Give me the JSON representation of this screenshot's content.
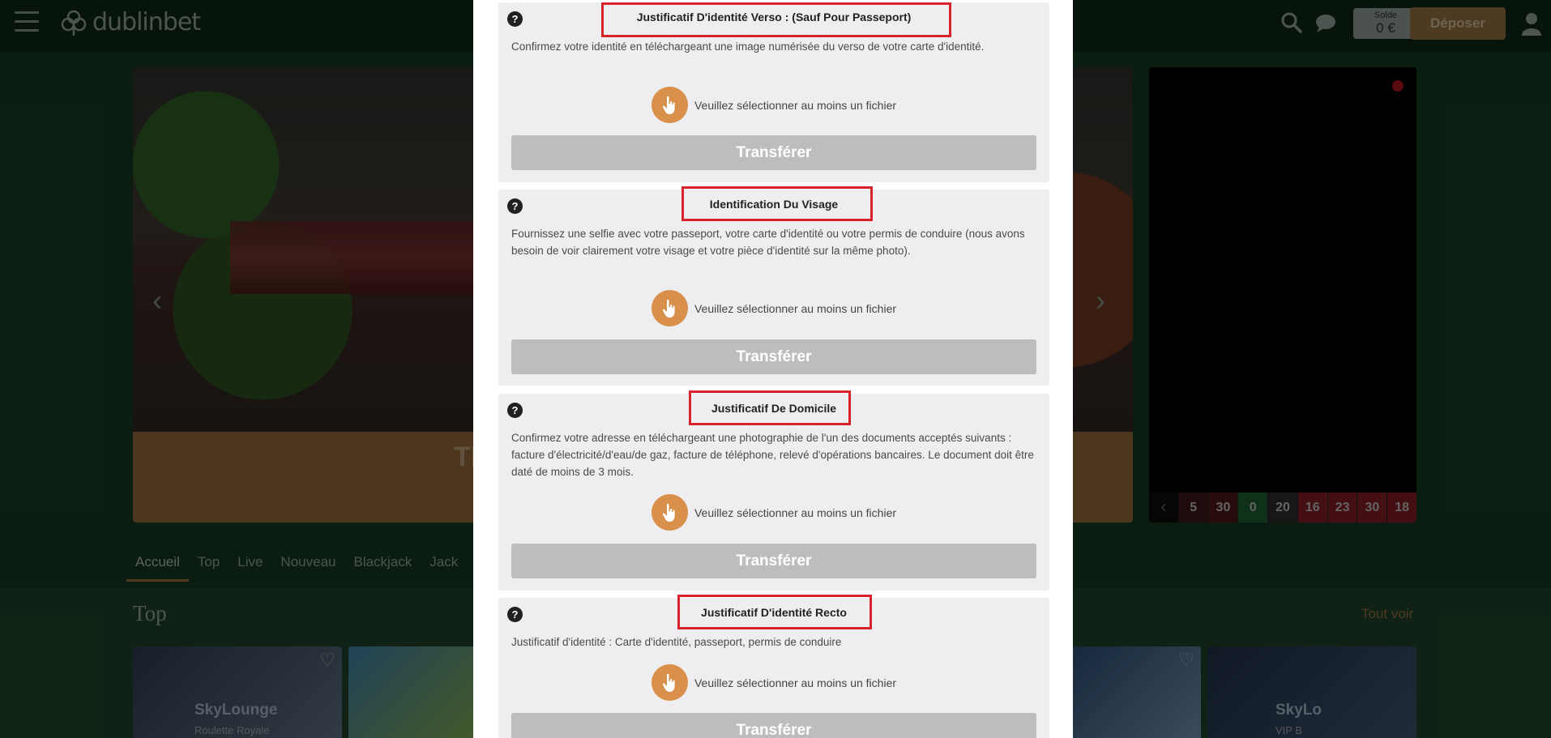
{
  "header": {
    "logo_text": "dublinbet",
    "balance_label": "Solde",
    "balance_value": "0 €",
    "deposit_label": "Déposer"
  },
  "hero": {
    "caption": "TI"
  },
  "roulette": {
    "numbers": [
      {
        "value": "5",
        "color": "#3a1414"
      },
      {
        "value": "30",
        "color": "#4a1717"
      },
      {
        "value": "0",
        "color": "#1e5a2e"
      },
      {
        "value": "20",
        "color": "#2a2a2a"
      },
      {
        "value": "16",
        "color": "#7a1c24"
      },
      {
        "value": "23",
        "color": "#7a1c24"
      },
      {
        "value": "30",
        "color": "#7a1c24"
      },
      {
        "value": "18",
        "color": "#7a1c24"
      }
    ]
  },
  "nav_tabs": [
    "Accueil",
    "Top",
    "Live",
    "Nouveau",
    "Blackjack",
    "Jack"
  ],
  "section": {
    "title": "Top",
    "see_all": "Tout voir"
  },
  "cards": [
    {
      "title": "SkyLounge",
      "subtitle": "Roulette Royale"
    },
    {
      "title": "SkyLo",
      "subtitle": "VIP B"
    }
  ],
  "modal": {
    "documents": [
      {
        "title": "Justificatif D'identité Verso : (Sauf Pour Passeport)",
        "description": "Confirmez votre identité en téléchargeant une image numérisée du verso de votre carte d'identité.",
        "file_hint": "Veuillez sélectionner au moins un fichier",
        "button": "Transférer"
      },
      {
        "title": "Identification Du Visage",
        "description": "Fournissez une selfie avec votre passeport, votre carte d'identité ou votre permis de conduire (nous avons besoin de voir clairement votre visage et votre pièce d'identité sur la même photo).",
        "file_hint": "Veuillez sélectionner au moins un fichier",
        "button": "Transférer"
      },
      {
        "title": "Justificatif De Domicile",
        "description": "Confirmez votre adresse en téléchargeant une photographie de l'un des documents acceptés suivants : facture d'électricité/d'eau/de gaz, facture de téléphone, relevé d'opérations bancaires. Le document doit être daté de moins de 3 mois.",
        "file_hint": "Veuillez sélectionner au moins un fichier",
        "button": "Transférer"
      },
      {
        "title": "Justificatif D'identité Recto",
        "description": "Justificatif d'identité : Carte d'identité, passeport, permis de conduire",
        "file_hint": "Veuillez sélectionner au moins un fichier",
        "button": "Transférer"
      }
    ]
  }
}
